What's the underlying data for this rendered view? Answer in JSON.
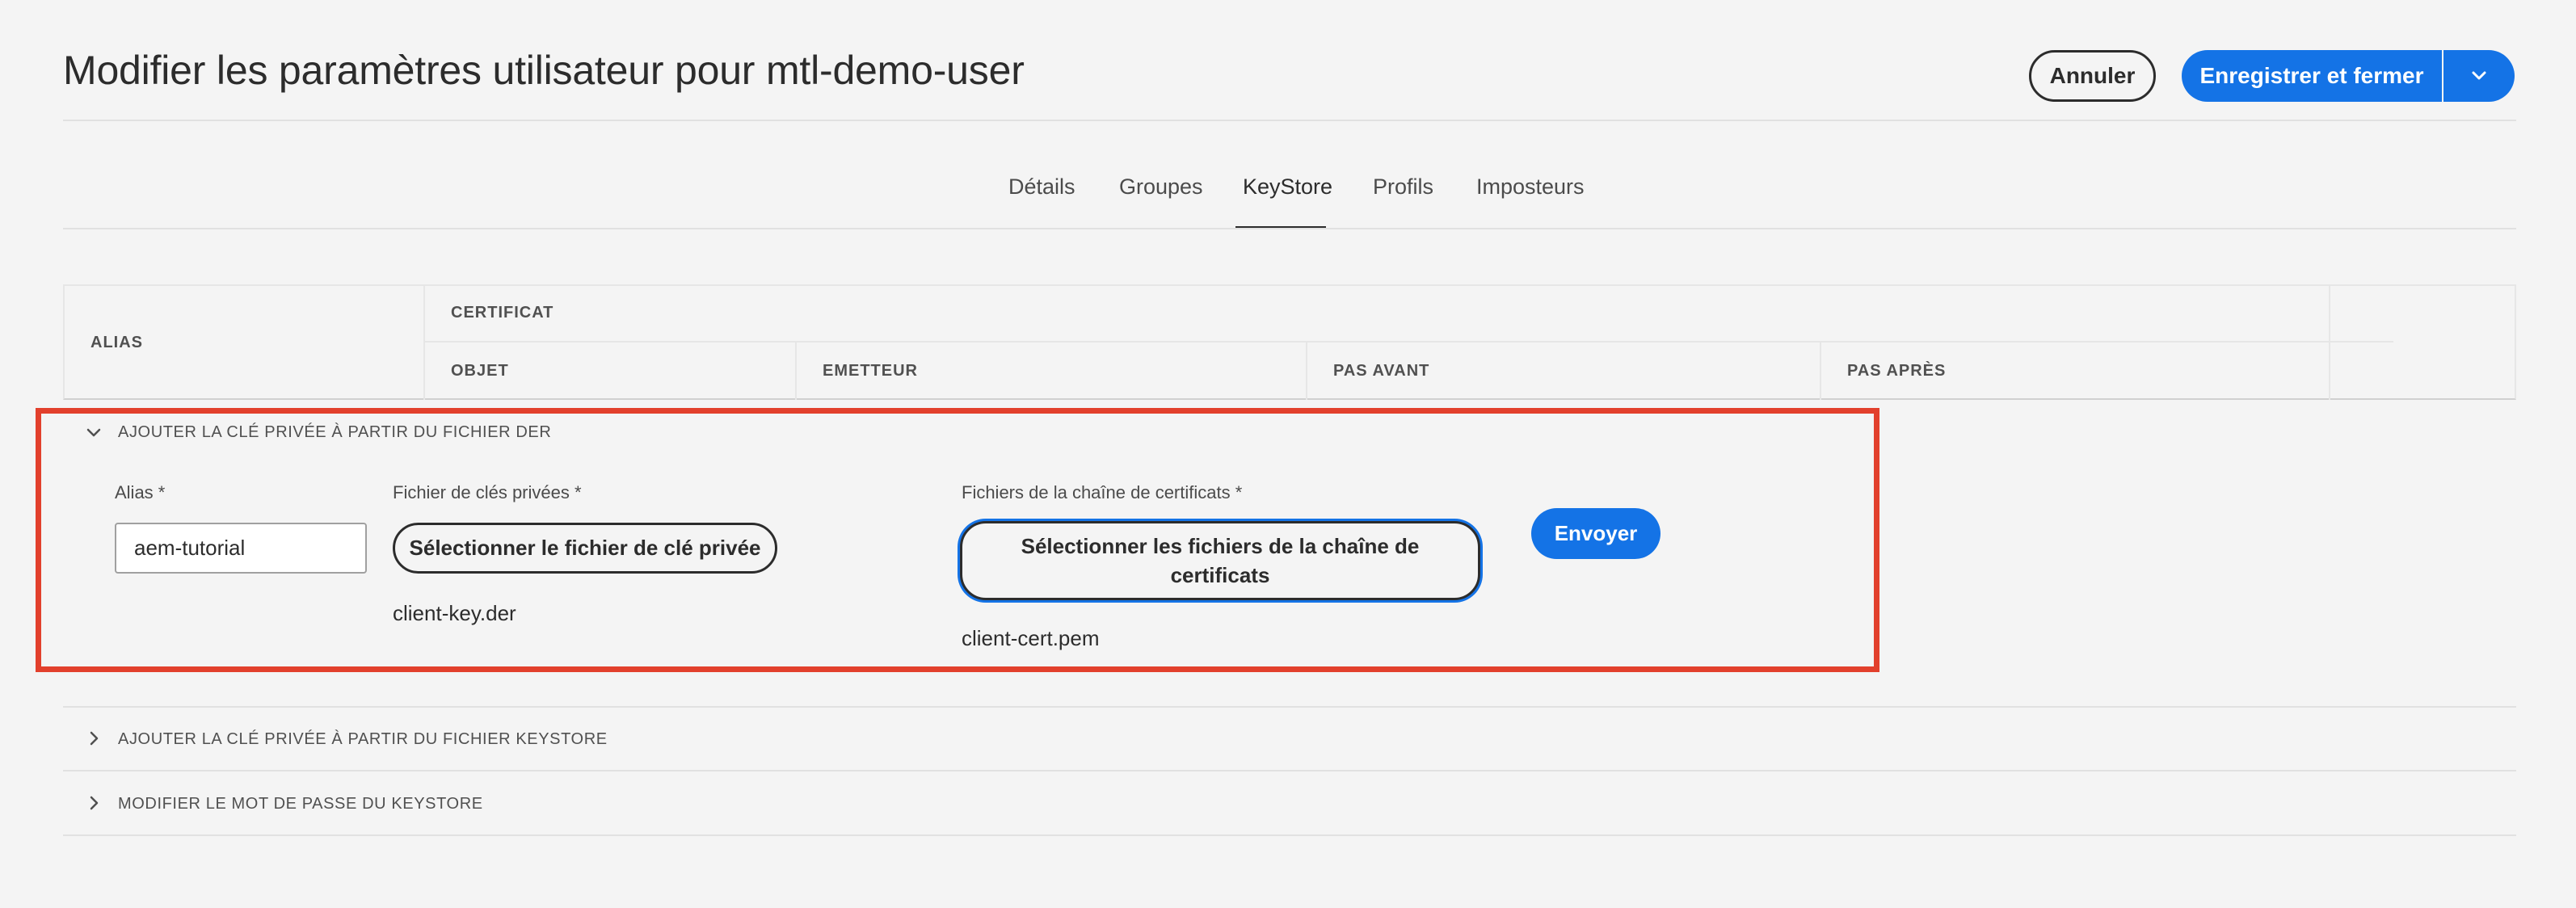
{
  "header": {
    "title": "Modifier les paramètres utilisateur pour mtl-demo-user",
    "cancel_label": "Annuler",
    "save_close_label": "Enregistrer et fermer"
  },
  "tabs": [
    {
      "label": "Détails"
    },
    {
      "label": "Groupes"
    },
    {
      "label": "KeyStore",
      "selected": true
    },
    {
      "label": "Profils"
    },
    {
      "label": "Imposteurs"
    }
  ],
  "table": {
    "alias": "ALIAS",
    "certificate": "CERTIFICAT",
    "subject": "OBJET",
    "issuer": "EMETTEUR",
    "not_before": "PAS AVANT",
    "not_after": "PAS APRÈS"
  },
  "accordion": {
    "der": {
      "label": "AJOUTER LA CLÉ PRIVÉE À PARTIR DU FICHIER DER",
      "expanded": true,
      "alias_label": "Alias *",
      "alias_value": "aem-tutorial",
      "private_key_label": "Fichier de clés privées *",
      "private_key_button": "Sélectionner le fichier de clé privée",
      "private_key_file": "client-key.der",
      "chain_label": "Fichiers de la chaîne de certificats *",
      "chain_button": "Sélectionner les fichiers de la chaîne de certificats",
      "chain_file": "client-cert.pem",
      "submit_label": "Envoyer"
    },
    "keystore": {
      "label": "AJOUTER LA CLÉ PRIVÉE À PARTIR DU FICHIER KEYSTORE",
      "expanded": false
    },
    "password": {
      "label": "MODIFIER LE MOT DE PASSE DU KEYSTORE",
      "expanded": false
    }
  },
  "colors": {
    "accent": "#1473e6",
    "highlight": "#e2402c"
  }
}
